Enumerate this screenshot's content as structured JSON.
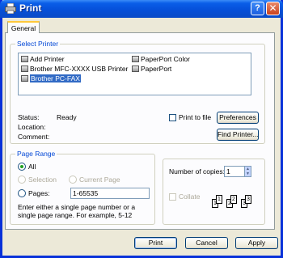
{
  "window": {
    "title": "Print",
    "help_glyph": "?",
    "close_glyph": "✕"
  },
  "tabs": [
    {
      "label": "General"
    }
  ],
  "select_printer": {
    "legend": "Select Printer",
    "printers": [
      {
        "name": "Add Printer",
        "icon": "add-printer-icon"
      },
      {
        "name": "PaperPort Color",
        "icon": "printer-icon"
      },
      {
        "name": "Brother MFC-XXXX USB Printer",
        "icon": "printer-icon"
      },
      {
        "name": "PaperPort",
        "icon": "printer-icon"
      },
      {
        "name": "Brother PC-FAX",
        "icon": "fax-icon",
        "selected": true
      }
    ],
    "status_label": "Status:",
    "status_value": "Ready",
    "location_label": "Location:",
    "comment_label": "Comment:",
    "print_to_file": "Print to file",
    "preferences_button": "Preferences",
    "find_printer_button": "Find Printer..."
  },
  "page_range": {
    "legend": "Page Range",
    "all": "All",
    "selection": "Selection",
    "current_page": "Current Page",
    "pages": "Pages:",
    "pages_value": "1-65535",
    "hint": "Enter either a single page number or a single page range.  For example, 5-12"
  },
  "copies": {
    "label": "Number of copies:",
    "value": "1",
    "collate": "Collate",
    "collate_pages": [
      "1",
      "1",
      "2",
      "2",
      "3",
      "3"
    ]
  },
  "footer": {
    "print": "Print",
    "cancel": "Cancel",
    "apply": "Apply"
  },
  "colors": {
    "accent": "#0046d5",
    "selection": "#316ac5",
    "titlebar": "#0650d9"
  }
}
